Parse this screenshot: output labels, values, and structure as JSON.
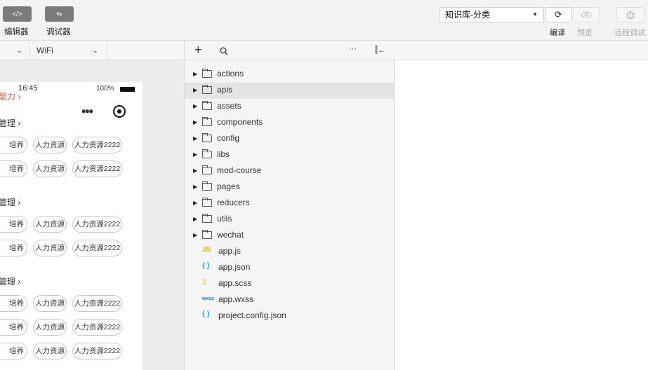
{
  "toolbar": {
    "editor_label": "编辑器",
    "debugger_label": "调试器",
    "editor_icon": "code-icon",
    "debugger_icon": "sliders-icon",
    "compile_mode": "知识库-分类",
    "compile_label": "编译",
    "preview_label": "预览",
    "remote_debug_label": "远程调试"
  },
  "simulator": {
    "device_select": "",
    "network_select": "WiFi",
    "status_time": "16:45",
    "battery": "100%",
    "top_link": "能力 ›",
    "sections": [
      {
        "title": "管理 ›",
        "rows": [
          [
            "培养",
            "人力资源",
            "人力资源2222"
          ],
          [
            "培养",
            "人力资源",
            "人力资源2222"
          ]
        ]
      },
      {
        "title": "管理 ›",
        "rows": [
          [
            "培养",
            "人力资源",
            "人力资源2222"
          ],
          [
            "培养",
            "人力资源",
            "人力资源2222"
          ]
        ]
      },
      {
        "title": "管理 ›",
        "rows": [
          [
            "培养",
            "人力资源",
            "人力资源2222"
          ],
          [
            "培养",
            "人力资源",
            "人力资源2222"
          ],
          [
            "培养",
            "人力资源",
            "人力资源2222"
          ]
        ]
      }
    ]
  },
  "filetree": {
    "folders": [
      "actions",
      "apis",
      "assets",
      "components",
      "config",
      "libs",
      "mod-course",
      "pages",
      "reducers",
      "utils",
      "wechat"
    ],
    "selected": "apis",
    "files": [
      {
        "name": "app.js",
        "icon": "JS",
        "color": "#e5b800"
      },
      {
        "name": "app.json",
        "icon": "{ }",
        "color": "#2aa6d8"
      },
      {
        "name": "app.scss",
        "icon": "▯",
        "color": "#e5b800"
      },
      {
        "name": "app.wxss",
        "icon": "wxss",
        "color": "#2a6fd8"
      },
      {
        "name": "project.config.json",
        "icon": "{ }",
        "color": "#2aa6d8"
      }
    ],
    "more_label": "···"
  }
}
